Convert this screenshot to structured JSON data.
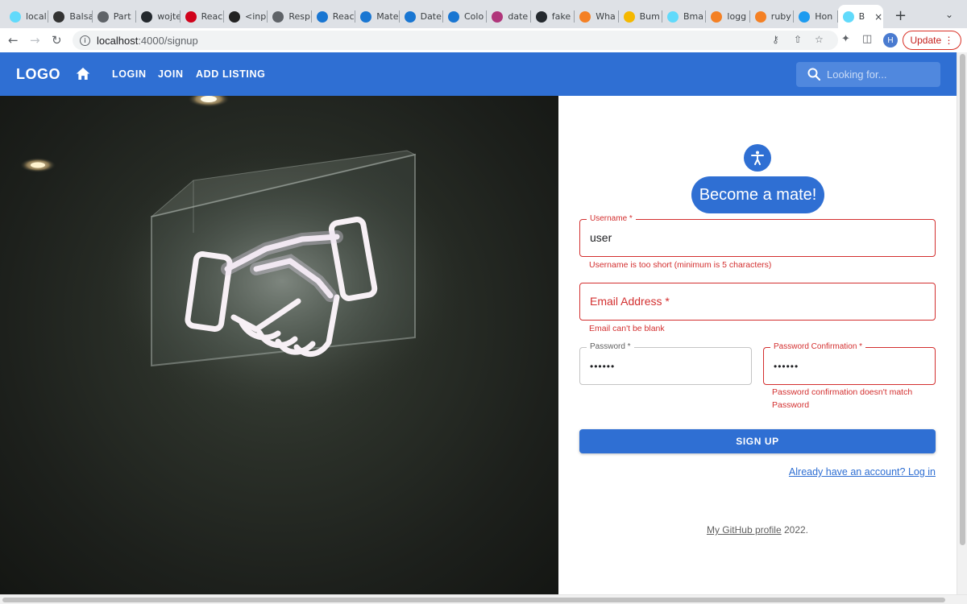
{
  "browser": {
    "tabs": [
      {
        "label": "local",
        "favicon": "react-icon",
        "color": "#61dafb"
      },
      {
        "label": "Balsa",
        "favicon": "balsamiq-icon",
        "color": "#333333"
      },
      {
        "label": "Part",
        "favicon": "document-icon",
        "color": "#5f6368"
      },
      {
        "label": "wojte",
        "favicon": "github-icon",
        "color": "#24292e"
      },
      {
        "label": "Reac",
        "favicon": "react-router-icon",
        "color": "#d0021b"
      },
      {
        "label": "<inp",
        "favicon": "spectrum-icon",
        "color": "#222222"
      },
      {
        "label": "Resp",
        "favicon": "page-icon",
        "color": "#5f6368"
      },
      {
        "label": "Reac",
        "favicon": "mui-icon",
        "color": "#1976d2"
      },
      {
        "label": "Mate",
        "favicon": "mui-icon",
        "color": "#1976d2"
      },
      {
        "label": "Date",
        "favicon": "mui-icon",
        "color": "#1976d2"
      },
      {
        "label": "Colo",
        "favicon": "mui-icon",
        "color": "#1976d2"
      },
      {
        "label": "date",
        "favicon": "regex-icon",
        "color": "#b0367b"
      },
      {
        "label": "fake",
        "favicon": "github-icon",
        "color": "#24292e"
      },
      {
        "label": "Wha",
        "favicon": "stackoverflow-icon",
        "color": "#f48024"
      },
      {
        "label": "Bum",
        "favicon": "bumble-icon",
        "color": "#f5b800"
      },
      {
        "label": "Bma",
        "favicon": "react-icon",
        "color": "#61dafb"
      },
      {
        "label": "logg",
        "favicon": "stackoverflow-icon",
        "color": "#f48024"
      },
      {
        "label": "ruby",
        "favicon": "stackoverflow-icon",
        "color": "#f48024"
      },
      {
        "label": "Hon",
        "favicon": "twitter-icon",
        "color": "#1d9bf0"
      },
      {
        "label": "B",
        "favicon": "react-icon",
        "color": "#61dafb",
        "active": true
      }
    ],
    "url_host": "localhost",
    "url_path": ":4000/signup",
    "update_label": "Update",
    "profile_initial": "H"
  },
  "appbar": {
    "logo": "LOGO",
    "nav": [
      "LOGIN",
      "JOIN",
      "ADD LISTING"
    ],
    "search_placeholder": "Looking for..."
  },
  "hero": {
    "image": "neon-handshake-sign-photo"
  },
  "form": {
    "heading": "Become a mate!",
    "username": {
      "label": "Username *",
      "value": "user",
      "error": "Username is too short (minimum is 5 characters)"
    },
    "email": {
      "label": "Email Address *",
      "value": "",
      "error": "Email can't be blank"
    },
    "password": {
      "label": "Password *",
      "value": "••••••"
    },
    "password_confirmation": {
      "label": "Password Confirmation *",
      "value": "••••••",
      "error_line1": "Password confirmation doesn't match",
      "error_line2": "Password"
    },
    "submit_label": "SIGN UP",
    "login_link": "Already have an account? Log in"
  },
  "footer": {
    "link_text": "My GitHub profile",
    "year_text": " 2022."
  },
  "colors": {
    "primary": "#2f6fd3",
    "error": "#d32f2f"
  }
}
